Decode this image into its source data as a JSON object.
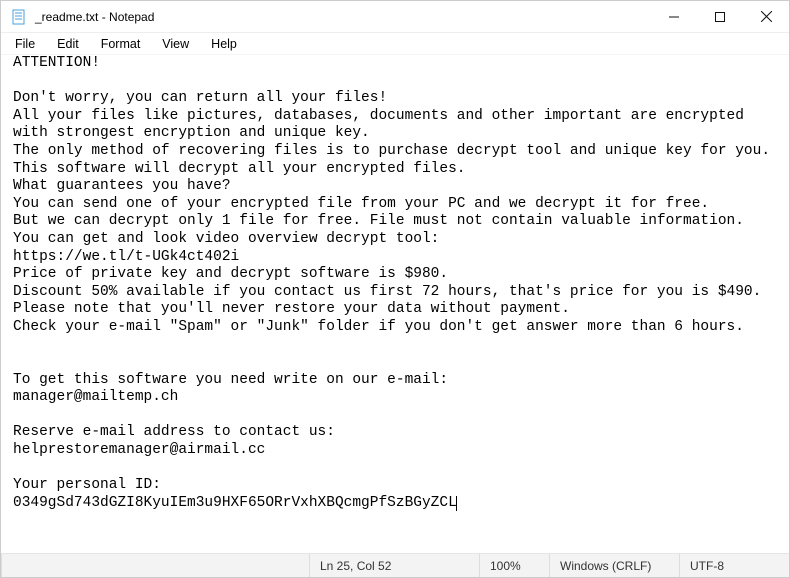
{
  "window": {
    "title": "_readme.txt - Notepad",
    "icon_name": "notepad-icon"
  },
  "menubar": {
    "items": [
      "File",
      "Edit",
      "Format",
      "View",
      "Help"
    ]
  },
  "document": {
    "text": "ATTENTION!\n\nDon't worry, you can return all your files!\nAll your files like pictures, databases, documents and other important are encrypted\nwith strongest encryption and unique key.\nThe only method of recovering files is to purchase decrypt tool and unique key for you.\nThis software will decrypt all your encrypted files.\nWhat guarantees you have?\nYou can send one of your encrypted file from your PC and we decrypt it for free.\nBut we can decrypt only 1 file for free. File must not contain valuable information.\nYou can get and look video overview decrypt tool:\nhttps://we.tl/t-UGk4ct402i\nPrice of private key and decrypt software is $980.\nDiscount 50% available if you contact us first 72 hours, that's price for you is $490.\nPlease note that you'll never restore your data without payment.\nCheck your e-mail \"Spam\" or \"Junk\" folder if you don't get answer more than 6 hours.\n\n\nTo get this software you need write on our e-mail:\nmanager@mailtemp.ch\n\nReserve e-mail address to contact us:\nhelprestoremanager@airmail.cc\n\nYour personal ID:\n0349gSd743dGZI8KyuIEm3u9HXF65ORrVxhXBQcmgPfSzBGyZCL"
  },
  "statusbar": {
    "position": "Ln 25, Col 52",
    "zoom": "100%",
    "line_ending": "Windows (CRLF)",
    "encoding": "UTF-8"
  }
}
